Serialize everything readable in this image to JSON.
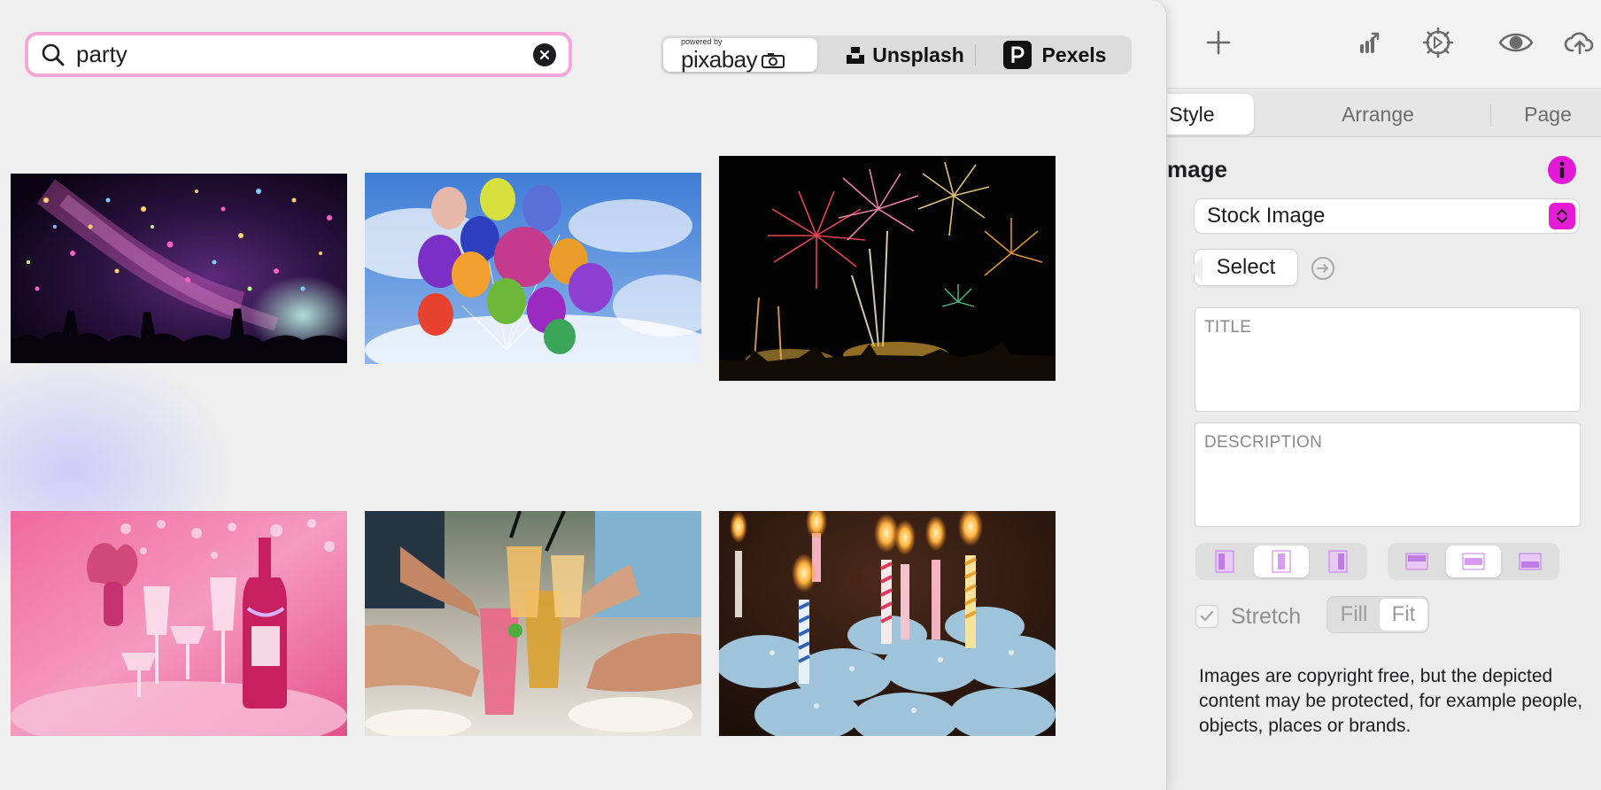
{
  "search": {
    "value": "party"
  },
  "providers": {
    "pixabay": {
      "tagline": "powered by",
      "label": "pixabay"
    },
    "unsplash": {
      "label": "Unsplash"
    },
    "pexels": {
      "label": "Pexels"
    }
  },
  "results": [
    {
      "id": "confetti",
      "subject": "confetti-crowd"
    },
    {
      "id": "balloons",
      "subject": "heart-balloons-sky"
    },
    {
      "id": "fireworks",
      "subject": "city-fireworks"
    },
    {
      "id": "champagne",
      "subject": "pink-champagne-table"
    },
    {
      "id": "toast",
      "subject": "cocktail-toast"
    },
    {
      "id": "cupcakes",
      "subject": "birthday-candle-cupcakes"
    }
  ],
  "inspector": {
    "tabs": [
      "Style",
      "Arrange",
      "Page"
    ],
    "active_tab": "Style",
    "section_title": "mage",
    "source_select": {
      "value": "Stock Image"
    },
    "select_button": "Select",
    "title_field": {
      "placeholder": "TITLE"
    },
    "description_field": {
      "placeholder": "DESCRIPTION"
    },
    "stretch": {
      "label": "Stretch",
      "checked": true
    },
    "fill_label": "Fill",
    "fit_label": "Fit",
    "disclaimer": "Images are copyright free, but the depicted content may be protected, for example people, objects, places or brands."
  },
  "colors": {
    "accent": "#e21ad6",
    "search_border": "#f5a6da",
    "panel_bg": "#ececec"
  }
}
